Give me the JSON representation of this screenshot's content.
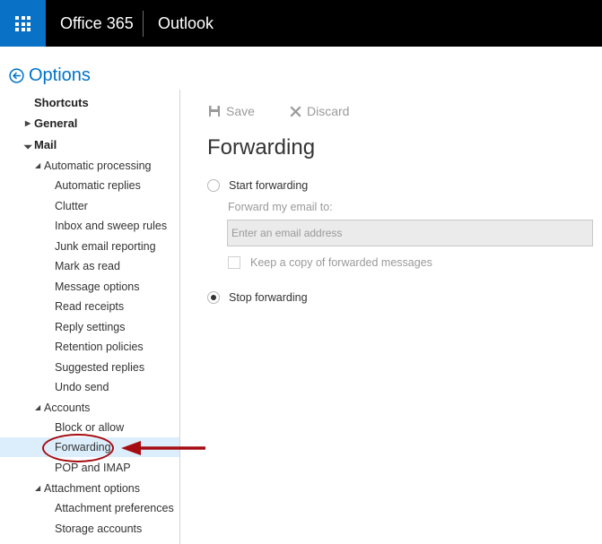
{
  "topbar": {
    "brand": "Office 365",
    "app": "Outlook",
    "waffle_icon": "app-launcher-icon"
  },
  "options": {
    "title": "Options",
    "back_icon": "back-circle-icon"
  },
  "sidebar": {
    "items": [
      {
        "label": "Shortcuts"
      },
      {
        "label": "General"
      },
      {
        "label": "Mail"
      },
      {
        "label": "Automatic processing"
      },
      {
        "label": "Automatic replies"
      },
      {
        "label": "Clutter"
      },
      {
        "label": "Inbox and sweep rules"
      },
      {
        "label": "Junk email reporting"
      },
      {
        "label": "Mark as read"
      },
      {
        "label": "Message options"
      },
      {
        "label": "Read receipts"
      },
      {
        "label": "Reply settings"
      },
      {
        "label": "Retention policies"
      },
      {
        "label": "Suggested replies"
      },
      {
        "label": "Undo send"
      },
      {
        "label": "Accounts"
      },
      {
        "label": "Block or allow"
      },
      {
        "label": "Forwarding"
      },
      {
        "label": "POP and IMAP"
      },
      {
        "label": "Attachment options"
      },
      {
        "label": "Attachment preferences"
      },
      {
        "label": "Storage accounts"
      }
    ]
  },
  "toolbar": {
    "save_label": "Save",
    "discard_label": "Discard"
  },
  "main": {
    "title": "Forwarding",
    "start_forwarding_label": "Start forwarding",
    "forward_to_label": "Forward my email to:",
    "email_placeholder": "Enter an email address",
    "keep_copy_label": "Keep a copy of forwarded messages",
    "stop_forwarding_label": "Stop forwarding",
    "selected_option": "Stop forwarding"
  },
  "colors": {
    "accent": "#0072c6",
    "annotation": "#a50d12",
    "selection": "#dceefb"
  }
}
